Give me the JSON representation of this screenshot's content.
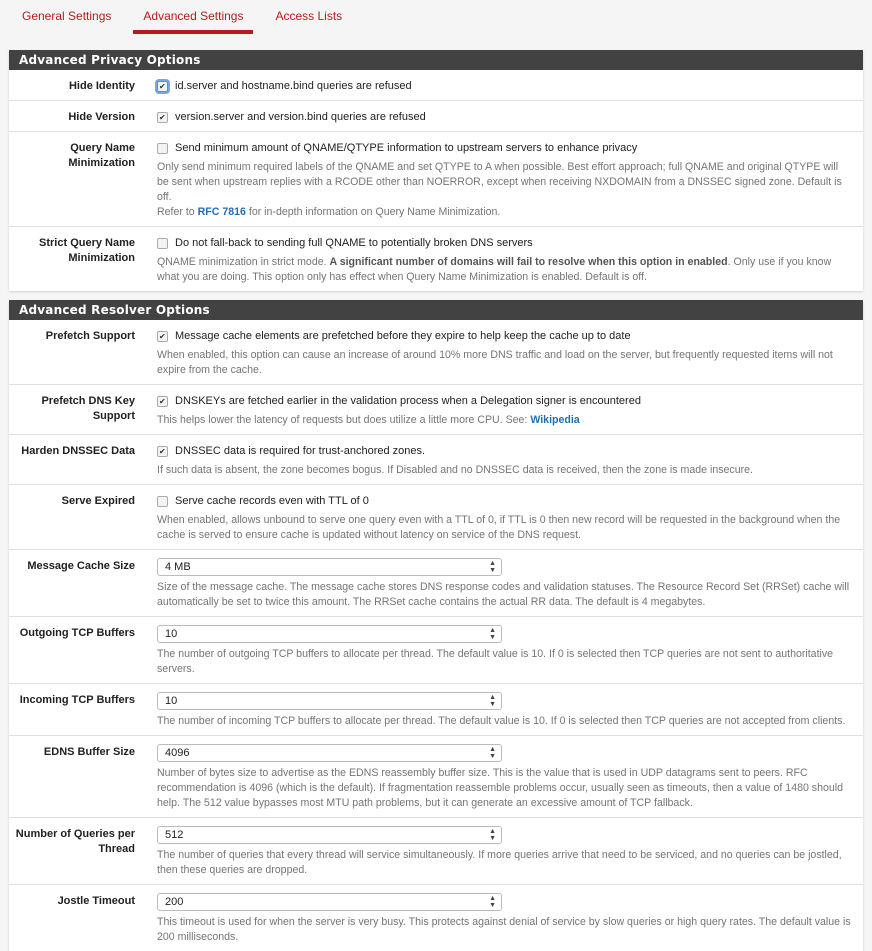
{
  "tabs": [
    {
      "label": "General Settings",
      "active": false
    },
    {
      "label": "Advanced Settings",
      "active": true
    },
    {
      "label": "Access Lists",
      "active": false
    }
  ],
  "privacy": {
    "title": "Advanced Privacy Options",
    "hide_identity": {
      "label": "Hide Identity",
      "checked": true,
      "text": "id.server and hostname.bind queries are refused"
    },
    "hide_version": {
      "label": "Hide Version",
      "checked": true,
      "text": "version.server and version.bind queries are refused"
    },
    "qname_min": {
      "label": "Query Name Minimization",
      "checked": false,
      "text": "Send minimum amount of QNAME/QTYPE information to upstream servers to enhance privacy",
      "help_1": "Only send minimum required labels of the QNAME and set QTYPE to A when possible. Best effort approach; full QNAME and original QTYPE will be sent when upstream replies with a RCODE other than NOERROR, except when receiving NXDOMAIN from a DNSSEC signed zone. Default is off.",
      "help_2": "Refer to ",
      "link": "RFC 7816",
      "help_3": " for in-depth information on Query Name Minimization."
    },
    "strict_qname": {
      "label": "Strict Query Name Minimization",
      "checked": false,
      "text": "Do not fall-back to sending full QNAME to potentially broken DNS servers",
      "help_1": "QNAME minimization in strict mode. ",
      "help_bold": "A significant number of domains will fail to resolve when this option in enabled",
      "help_2": ". Only use if you know what you are doing. This option only has effect when Query Name Minimization is enabled. Default is off."
    }
  },
  "resolver": {
    "title": "Advanced Resolver Options",
    "prefetch": {
      "label": "Prefetch Support",
      "checked": true,
      "text": "Message cache elements are prefetched before they expire to help keep the cache up to date",
      "help": "When enabled, this option can cause an increase of around 10% more DNS traffic and load on the server, but frequently requested items will not expire from the cache."
    },
    "prefetch_key": {
      "label": "Prefetch DNS Key Support",
      "checked": true,
      "text": "DNSKEYs are fetched earlier in the validation process when a Delegation signer is encountered",
      "help": "This helps lower the latency of requests but does utilize a little more CPU. See: ",
      "link": "Wikipedia"
    },
    "harden": {
      "label": "Harden DNSSEC Data",
      "checked": true,
      "text": "DNSSEC data is required for trust-anchored zones.",
      "help": "If such data is absent, the zone becomes bogus. If Disabled and no DNSSEC data is received, then the zone is made insecure."
    },
    "serve_expired": {
      "label": "Serve Expired",
      "checked": false,
      "text": "Serve cache records even with TTL of 0",
      "help": "When enabled, allows unbound to serve one query even with a TTL of 0, if TTL is 0 then new record will be requested in the background when the cache is served to ensure cache is updated without latency on service of the DNS request."
    },
    "msg_cache": {
      "label": "Message Cache Size",
      "value": "4 MB",
      "help": "Size of the message cache. The message cache stores DNS response codes and validation statuses. The Resource Record Set (RRSet) cache will automatically be set to twice this amount. The RRSet cache contains the actual RR data. The default is 4 megabytes."
    },
    "out_tcp": {
      "label": "Outgoing TCP Buffers",
      "value": "10",
      "help": "The number of outgoing TCP buffers to allocate per thread. The default value is 10. If 0 is selected then TCP queries are not sent to authoritative servers."
    },
    "in_tcp": {
      "label": "Incoming TCP Buffers",
      "value": "10",
      "help": "The number of incoming TCP buffers to allocate per thread. The default value is 10. If 0 is selected then TCP queries are not accepted from clients."
    },
    "edns": {
      "label": "EDNS Buffer Size",
      "value": "4096",
      "help": "Number of bytes size to advertise as the EDNS reassembly buffer size. This is the value that is used in UDP datagrams sent to peers. RFC recommendation is 4096 (which is the default). If fragmentation reassemble problems occur, usually seen as timeouts, then a value of 1480 should help. The 512 value bypasses most MTU path problems, but it can generate an excessive amount of TCP fallback."
    },
    "queries": {
      "label": "Number of Queries per Thread",
      "value": "512",
      "help": "The number of queries that every thread will service simultaneously. If more queries arrive that need to be serviced, and no queries can be jostled, then these queries are dropped."
    },
    "jostle": {
      "label": "Jostle Timeout",
      "value": "200",
      "help": "This timeout is used for when the server is very busy. This protects against denial of service by slow queries or high query rates. The default value is 200 milliseconds."
    }
  },
  "colors": {
    "accent": "#b71c1c",
    "heading_bg": "#424242",
    "link": "#1e6fb7"
  }
}
